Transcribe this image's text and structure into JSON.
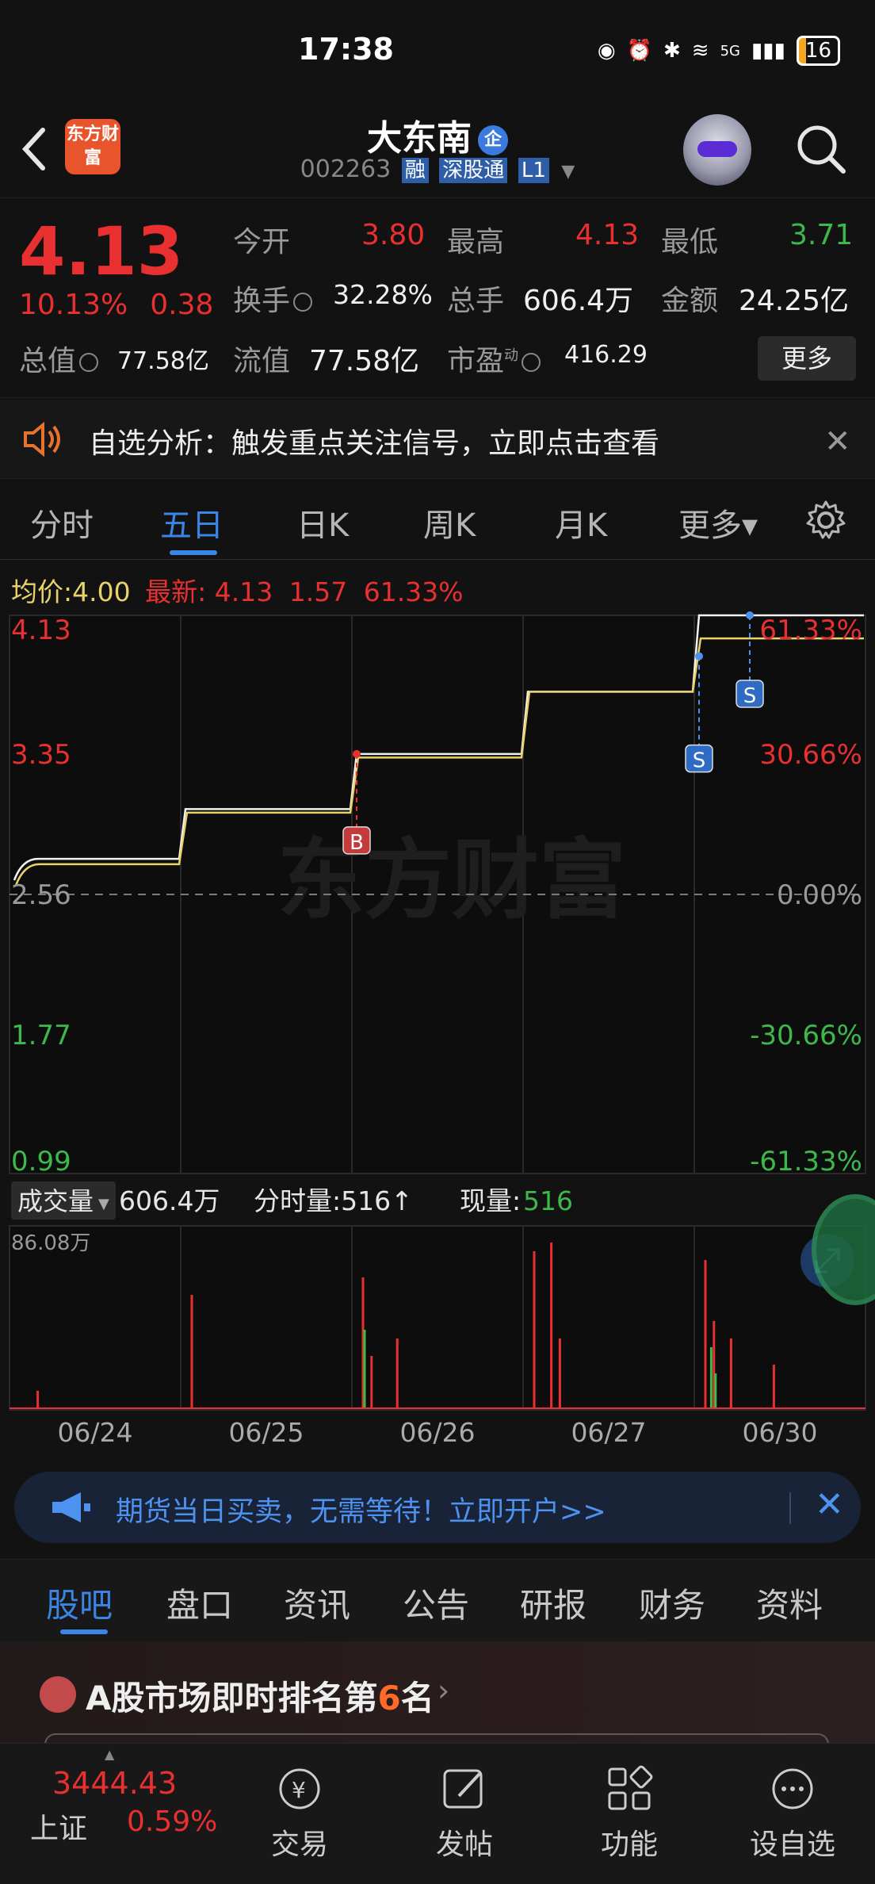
{
  "status": {
    "time": "17:38",
    "network": "5G",
    "battery": "16"
  },
  "nav": {
    "logo_text": "东方财富",
    "name": "大东南",
    "ent_tag": "企",
    "code": "002263",
    "tags": [
      "融",
      "深股通",
      "L1"
    ]
  },
  "quote": {
    "price": "4.13",
    "change_pct": "10.13%",
    "change": "0.38",
    "cells": [
      {
        "label": "今开",
        "value": "3.80",
        "color": "red"
      },
      {
        "label": "最高",
        "value": "4.13",
        "color": "red"
      },
      {
        "label": "最低",
        "value": "3.71",
        "color": "green"
      },
      {
        "label": "换手",
        "value": "32.28%",
        "color": "white"
      },
      {
        "label": "总手",
        "value": "606.4万",
        "color": "white"
      },
      {
        "label": "金额",
        "value": "24.25亿",
        "color": "white"
      },
      {
        "label": "总值",
        "value": "77.58亿",
        "color": "white"
      },
      {
        "label": "流值",
        "value": "77.58亿",
        "color": "white"
      },
      {
        "label": "市盈",
        "value": "416.29",
        "color": "white"
      }
    ],
    "pe_sup": "动",
    "more": "更多"
  },
  "notice": {
    "text": "自选分析：触发重点关注信号，立即点击查看"
  },
  "tabs": [
    "分时",
    "五日",
    "日K",
    "周K",
    "月K",
    "更多▾"
  ],
  "chart": {
    "avg_label": "均价:",
    "avg_value": "4.00",
    "latest_label": "最新:",
    "latest_value": "4.13",
    "latest_change": "1.57",
    "latest_pct": "61.33%",
    "left_axis": [
      "4.13",
      "3.35",
      "2.56",
      "1.77",
      "0.99"
    ],
    "right_axis": [
      "61.33%",
      "30.66%",
      "0.00%",
      "-30.66%",
      "-61.33%"
    ],
    "watermark": "东方财富",
    "markers": [
      "B",
      "S",
      "S"
    ],
    "volume_label": "成交量",
    "volume_total": "606.4万",
    "tick_vol_label": "分时量:516↑",
    "cur_vol_label": "现量:",
    "cur_vol_value": "516",
    "vol_max": "86.08万",
    "dates": [
      "06/24",
      "06/25",
      "06/26",
      "06/27",
      "06/30"
    ]
  },
  "chart_data": {
    "type": "line",
    "title": "",
    "x": [
      "06/24",
      "06/25",
      "06/26",
      "06/27",
      "06/30"
    ],
    "series": [
      {
        "name": "最新",
        "values": [
          2.76,
          3.04,
          3.35,
          3.7,
          4.13
        ]
      },
      {
        "name": "均价",
        "values": [
          2.73,
          3.02,
          3.33,
          3.7,
          4.0
        ]
      }
    ],
    "ylim": [
      0.99,
      4.13
    ],
    "volume_max": "86.08万"
  },
  "ad": {
    "text": "期货当日买卖，无需等待！立即开户>>"
  },
  "sub_tabs": [
    "股吧",
    "盘口",
    "资讯",
    "公告",
    "研报",
    "财务",
    "资料"
  ],
  "rank": {
    "prefix": "A股市场即时排名第",
    "num": "6",
    "suffix": "名"
  },
  "bottom": {
    "index_value": "3444.43",
    "index_name": "上证",
    "index_pct": "0.59%",
    "items": [
      "交易",
      "发帖",
      "功能",
      "设自选"
    ]
  },
  "colors": {
    "up": "#e93030",
    "down": "#3cb94a",
    "accent": "#3a86e6",
    "avg_line": "#e8d36a"
  }
}
